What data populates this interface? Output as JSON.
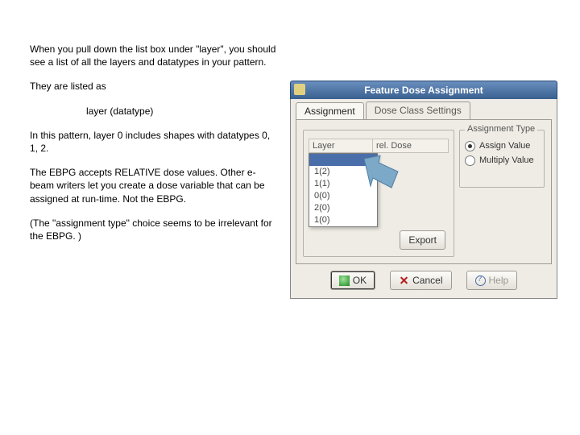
{
  "text": {
    "p1": "When you pull down the list box under \"layer\", you should see a list of all the layers and datatypes in your pattern.",
    "p2": "They are listed as",
    "p3": "layer (datatype)",
    "p4": "In this pattern, layer 0 includes shapes with datatypes 0, 1, 2.",
    "p5": "The EBPG accepts RELATIVE dose values.  Other e-beam writers let you create a dose variable that can be assigned at run-time.  Not the EBPG.",
    "p6": "(The \"assignment type\" choice seems to be irrelevant for the EBPG. )"
  },
  "dialog": {
    "title": "Feature Dose Assignment",
    "tabs": {
      "assignment": "Assignment",
      "doseclass": "Dose Class Settings"
    },
    "cols": {
      "layer": "Layer",
      "reldose": "rel. Dose"
    },
    "dropdown": [
      "1(2)",
      "1(1)",
      "0(0)",
      "2(0)",
      "1(0)"
    ],
    "export": "Export",
    "group_right": "Assignment Type",
    "radios": {
      "assign": "Assign Value",
      "multiply": "Multiply Value"
    },
    "buttons": {
      "ok": "OK",
      "cancel": "Cancel",
      "help": "Help"
    }
  }
}
